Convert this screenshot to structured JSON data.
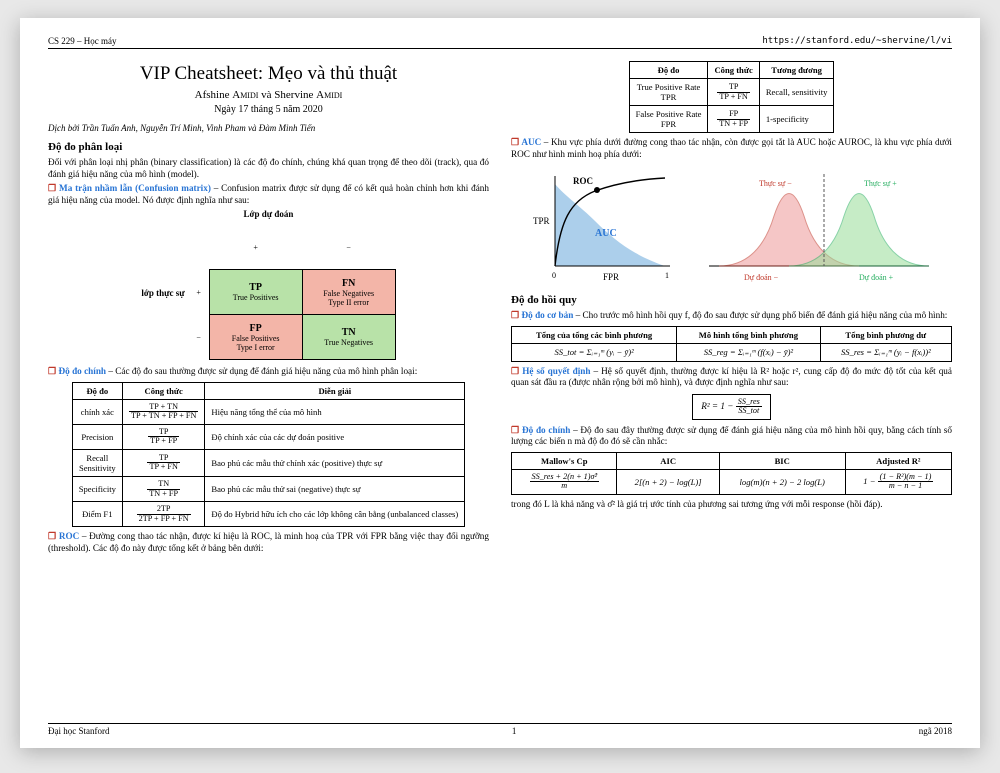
{
  "header": {
    "left": "CS 229 – Học máy",
    "right": "https://stanford.edu/~shervine/l/vi"
  },
  "title": "VIP Cheatsheet: Mẹo và thủ thuật",
  "authors_prefix": "Afshine ",
  "author1": "Amidi",
  "authors_mid": " và Shervine ",
  "author2": "Amidi",
  "date": "Ngày 17 tháng 5 năm 2020",
  "translators": "Dịch bởi Trần Tuấn Anh, Nguyễn Trí Minh, Vinh Pham và Đàm Minh Tiến",
  "sec1": "Độ đo phân loại",
  "p1": "Đối với phân loại nhị phân (binary classification) là các độ đo chính, chúng khá quan trọng để theo dõi (track), qua đó đánh giá hiệu năng của mô hình (model).",
  "conf_heading": "Ma trận nhầm lẫn (Confusion matrix)",
  "conf_text": " – Confusion matrix được sử dụng để có kết quả hoàn chỉnh hơn khi đánh giá hiệu năng của model. Nó được định nghĩa như sau:",
  "conf_top": "Lớp dự đoán",
  "conf_side": "lớp thực sự",
  "conf": {
    "tp": {
      "a": "TP",
      "b": "True Positives"
    },
    "fn": {
      "a": "FN",
      "b": "False Negatives",
      "c": "Type II error"
    },
    "fp": {
      "a": "FP",
      "b": "False Positives",
      "c": "Type I error"
    },
    "tn": {
      "a": "TN",
      "b": "True Negatives"
    }
  },
  "main_heading": "Độ đo chính",
  "main_text": " – Các độ đo sau thường được sử dụng để đánh giá hiệu năng của mô hình phân loại:",
  "metrics_hdr": {
    "a": "Độ đo",
    "b": "Công thức",
    "c": "Diễn giải"
  },
  "metrics": [
    {
      "name": "chính xác",
      "num": "TP + TN",
      "den": "TP + TN + FP + FN",
      "desc": "Hiệu năng tổng thể của mô hình"
    },
    {
      "name": "Precision",
      "num": "TP",
      "den": "TP + FP",
      "desc": "Độ chính xác của các dự đoán positive"
    },
    {
      "name": "Recall\nSensitivity",
      "num": "TP",
      "den": "TP + FN",
      "desc": "Bao phủ các mẫu thử chính xác (positive) thực sự"
    },
    {
      "name": "Specificity",
      "num": "TN",
      "den": "TN + FP",
      "desc": "Bao phủ các mẫu thử sai (negative) thực sự"
    },
    {
      "name": "Điểm F1",
      "num": "2TP",
      "den": "2TP + FP + FN",
      "desc": "Độ đo Hybrid hữu ích cho các lớp không cân bằng (unbalanced classes)"
    }
  ],
  "roc_heading": "ROC",
  "roc_text": " – Đường cong thao tác nhận, được kí hiệu là ROC, là minh hoạ của TPR với FPR bằng việc thay đổi ngưỡng (threshold). Các độ đo này được tổng kết ở bảng bên dưới:",
  "roc_hdr": {
    "a": "Độ đo",
    "b": "Công thức",
    "c": "Tương đương"
  },
  "roc_rows": [
    {
      "name": "True Positive Rate\nTPR",
      "num": "TP",
      "den": "TP + FN",
      "eq": "Recall, sensitivity"
    },
    {
      "name": "False Positive Rate\nFPR",
      "num": "FP",
      "den": "TN + FP",
      "eq": "1-specificity"
    }
  ],
  "auc_heading": "AUC",
  "auc_text": " – Khu vực phía dưới đường cong thao tác nhận, còn được gọi tắt là AUC hoặc AUROC, là khu vực phía dưới ROC như hình minh hoạ phía dưới:",
  "roc_plot": {
    "y": "TPR",
    "x": "FPR",
    "roc": "ROC",
    "auc": "AUC",
    "t0": "0",
    "t1": "1"
  },
  "dist_plot": {
    "tn": "Thực sự −",
    "tp": "Thực sự +",
    "pn": "Dự đoán −",
    "pp": "Dự đoán +"
  },
  "sec2": "Độ đo hồi quy",
  "basic_heading": "Độ đo cơ bản",
  "basic_text": " – Cho trước mô hình hồi quy f, độ đo sau được sử dụng phổ biến để đánh giá hiệu năng của mô hình:",
  "ss_hdr": {
    "a": "Tổng của tổng các bình phương",
    "b": "Mô hình tổng bình phương",
    "c": "Tổng bình phương dư"
  },
  "ss": {
    "tot": "SS_tot = Σᵢ₌₁ᵐ (yᵢ − ȳ)²",
    "reg": "SS_reg = Σᵢ₌₁ᵐ (f(xᵢ) − ȳ)²",
    "res": "SS_res = Σᵢ₌₁ᵐ (yᵢ − f(xᵢ))²"
  },
  "r2_heading": "Hệ số quyết định",
  "r2_text": " – Hệ số quyết định, thường được kí hiệu là R² hoặc r², cung cấp độ đo mức độ tốt của kết quả quan sát đầu ra (được nhân rộng bởi mô hình), và được định nghĩa như sau:",
  "r2_formula_left": "R² = 1 − ",
  "r2_num": "SS_res",
  "r2_den": "SS_tot",
  "main2_heading": "Độ đo chính",
  "main2_text": " – Độ đo sau đây thường được sử dụng để đánh giá hiệu năng của mô hình hồi quy, bằng cách tính số lượng các biến n mà độ đo đó sẽ cần nhắc:",
  "adv_hdr": {
    "a": "Mallow's Cp",
    "b": "AIC",
    "c": "BIC",
    "d": "Adjusted R²"
  },
  "adv": {
    "cp_num": "SS_res + 2(n + 1)σ̂²",
    "cp_den": "m",
    "aic": "2[(n + 2) − log(L)]",
    "bic": "log(m)(n + 2) − 2 log(L)",
    "adj_left": "1 − ",
    "adj_num": "(1 − R²)(m − 1)",
    "adj_den": "m − n − 1"
  },
  "tail": "trong đó L là khả năng và σ̂² là giá trị ước tính của phương sai tương ứng với mỗi response (hồi đáp).",
  "footer": {
    "left": "Đại học Stanford",
    "mid": "1",
    "right": "ngã 2018"
  },
  "chart_data": [
    {
      "type": "area",
      "title": "ROC curve",
      "xlabel": "FPR",
      "ylabel": "TPR",
      "xlim": [
        0,
        1
      ],
      "ylim": [
        0,
        1
      ],
      "series": [
        {
          "name": "ROC",
          "x": [
            0,
            0.05,
            0.15,
            0.35,
            0.6,
            1
          ],
          "y": [
            0,
            0.55,
            0.78,
            0.92,
            0.98,
            1
          ]
        }
      ],
      "annotations": [
        "AUC shaded area"
      ]
    },
    {
      "type": "area",
      "title": "Class distributions with threshold",
      "series": [
        {
          "name": "Thực sự −",
          "color": "#e26a64",
          "x": [
            0,
            1,
            2,
            3,
            4,
            5,
            6
          ],
          "y": [
            0,
            0.1,
            0.45,
            0.9,
            0.45,
            0.1,
            0
          ]
        },
        {
          "name": "Thực sự +",
          "color": "#7bbf5a",
          "x": [
            3,
            4,
            5,
            6,
            7,
            8,
            9
          ],
          "y": [
            0,
            0.1,
            0.45,
            0.9,
            0.45,
            0.1,
            0
          ]
        }
      ],
      "threshold": 4.5,
      "xlabels": [
        "Dự đoán −",
        "Dự đoán +"
      ]
    }
  ]
}
